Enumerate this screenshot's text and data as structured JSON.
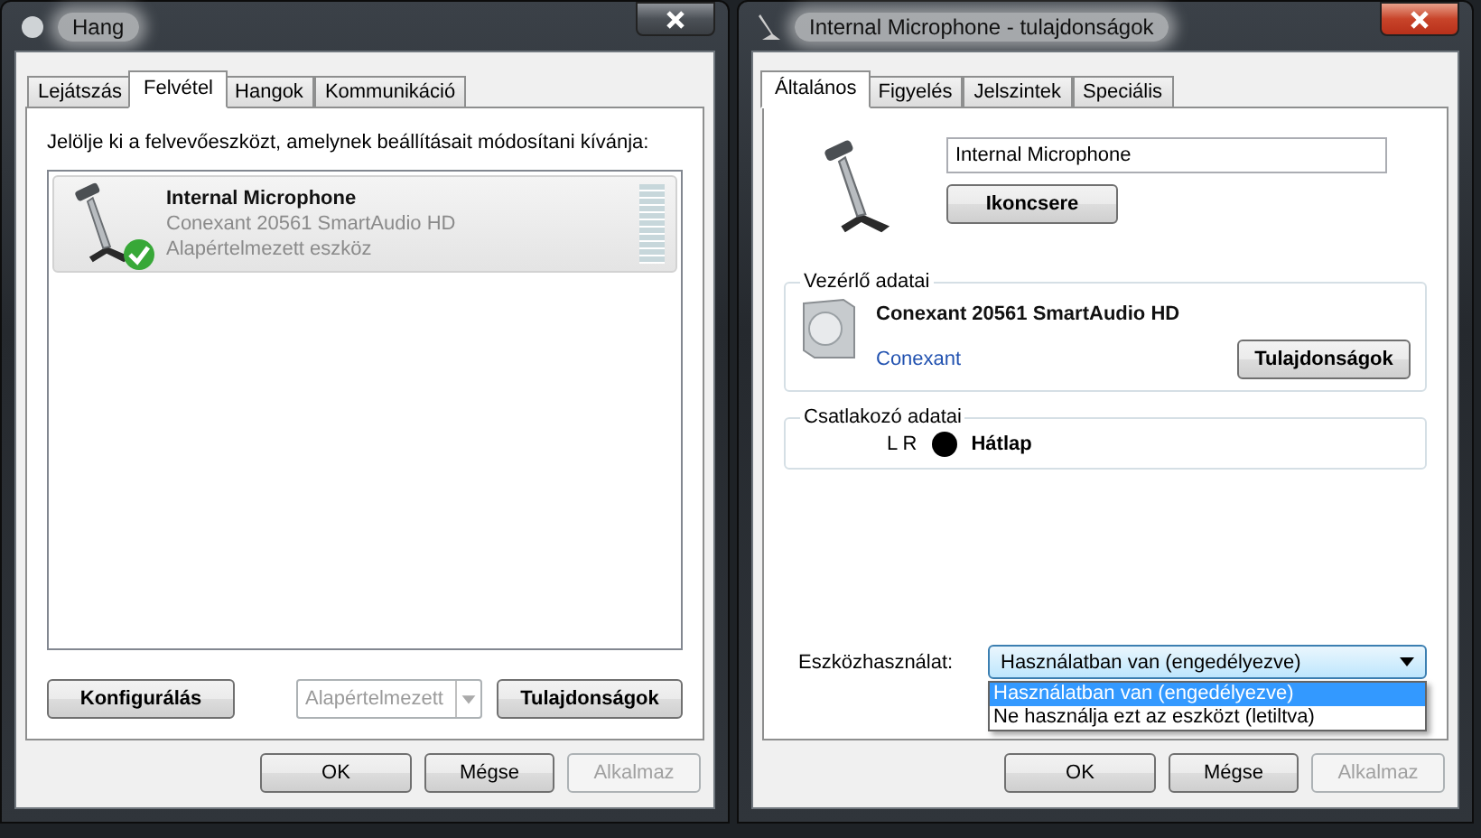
{
  "sound_window": {
    "title": "Hang",
    "tabs": [
      {
        "label": "Lejátszás",
        "selected": false
      },
      {
        "label": "Felvétel",
        "selected": true
      },
      {
        "label": "Hangok",
        "selected": false
      },
      {
        "label": "Kommunikáció",
        "selected": false
      }
    ],
    "instruction": "Jelölje ki a felvevőeszközt, amelynek beállításait módosítani kívánja:",
    "devices": [
      {
        "name": "Internal Microphone",
        "driver": "Conexant 20561 SmartAudio HD",
        "status": "Alapértelmezett eszköz",
        "selected": true,
        "default": true
      }
    ],
    "configure_button": "Konfigurálás",
    "default_dropdown": {
      "value": "Alapértelmezett",
      "disabled": true
    },
    "properties_button": "Tulajdonságok",
    "dialog_buttons": [
      {
        "label": "OK",
        "disabled": false
      },
      {
        "label": "Mégse",
        "disabled": false
      },
      {
        "label": "Alkalmaz",
        "disabled": true
      }
    ]
  },
  "properties_window": {
    "title": "Internal Microphone - tulajdonságok",
    "tabs": [
      {
        "label": "Általános",
        "selected": true
      },
      {
        "label": "Figyelés",
        "selected": false
      },
      {
        "label": "Jelszintek",
        "selected": false
      },
      {
        "label": "Speciális",
        "selected": false
      }
    ],
    "name_field": "Internal Microphone",
    "change_icon_button": "Ikoncsere",
    "controller": {
      "title": "Vezérlő adatai",
      "name": "Conexant 20561 SmartAudio HD",
      "vendor": "Conexant",
      "button": "Tulajdonságok"
    },
    "jack": {
      "title": "Csatlakozó adatai",
      "channels": "L R",
      "color": "#000000",
      "location": "Hátlap"
    },
    "usage": {
      "label": "Eszközhasználat:",
      "value": "Használatban van (engedélyezve)",
      "expanded": true,
      "options": [
        {
          "label": "Használatban van (engedélyezve)",
          "selected": true
        },
        {
          "label": "Ne használja ezt az eszközt (letiltva)",
          "selected": false
        }
      ]
    },
    "dialog_buttons": [
      {
        "label": "OK",
        "disabled": false
      },
      {
        "label": "Mégse",
        "disabled": false
      },
      {
        "label": "Alkalmaz",
        "disabled": true
      }
    ]
  }
}
